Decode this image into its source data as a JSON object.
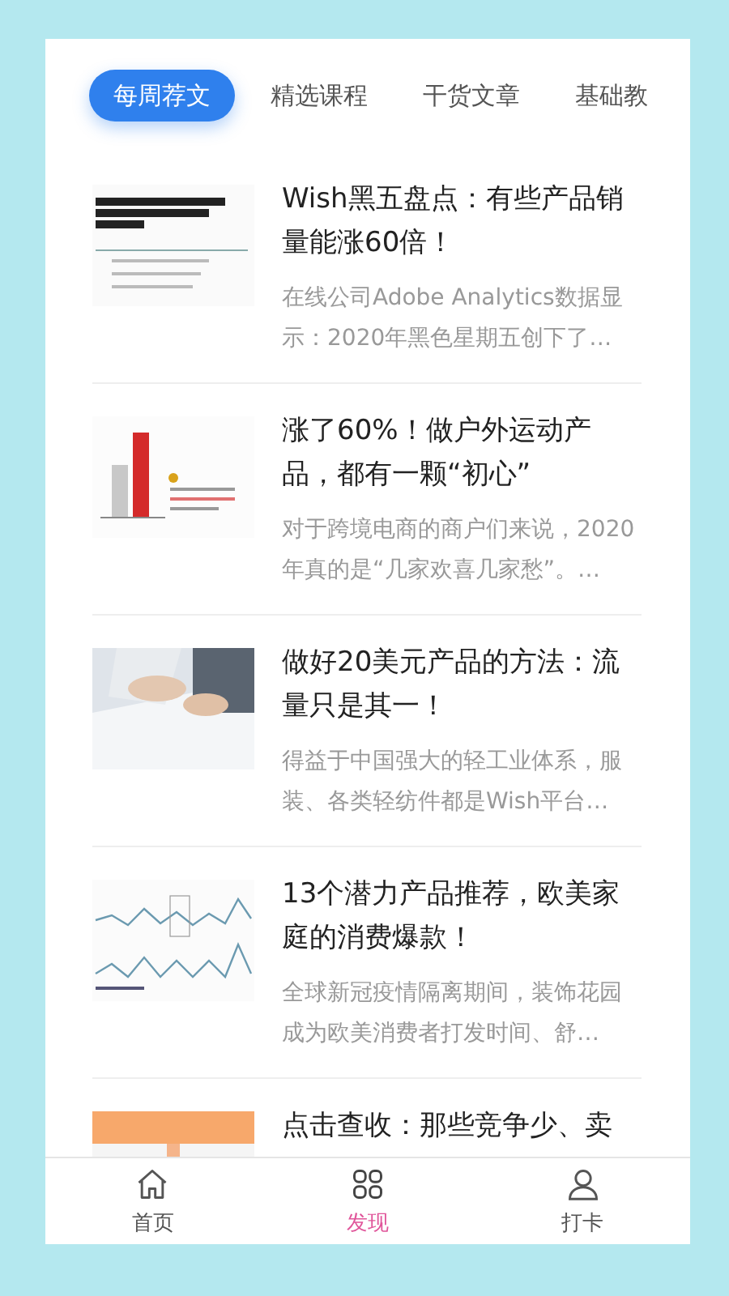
{
  "tabs": [
    {
      "label": "每周荐文",
      "selected": true
    },
    {
      "label": "精选课程",
      "selected": false
    },
    {
      "label": "干货文章",
      "selected": false
    },
    {
      "label": "基础教",
      "selected": false
    }
  ],
  "articles": [
    {
      "title": "Wish黑五盘点：有些产品销量能涨60倍！",
      "excerpt": "在线公司Adobe Analytics数据显示：2020年黑色星期五创下了…"
    },
    {
      "title": "涨了60%！做户外运动产品，都有一颗“初心”",
      "excerpt": "对于跨境电商的商户们来说，2020年真的是“几家欢喜几家愁”。…"
    },
    {
      "title": "做好20美元产品的方法：流量只是其一！",
      "excerpt": "得益于中国强大的轻工业体系，服装、各类轻纺件都是Wish平台…"
    },
    {
      "title": "13个潜力产品推荐，欧美家庭的消费爆款！",
      "excerpt": "全球新冠疫情隔离期间，装饰花园成为欧美消费者打发时间、舒…"
    },
    {
      "title": "点击查收：那些竞争少、卖"
    }
  ],
  "nav": [
    {
      "kind": "home",
      "label": "首页",
      "selected": false
    },
    {
      "kind": "grid",
      "label": "发现",
      "selected": true
    },
    {
      "kind": "person",
      "label": "打卡",
      "selected": false
    }
  ]
}
